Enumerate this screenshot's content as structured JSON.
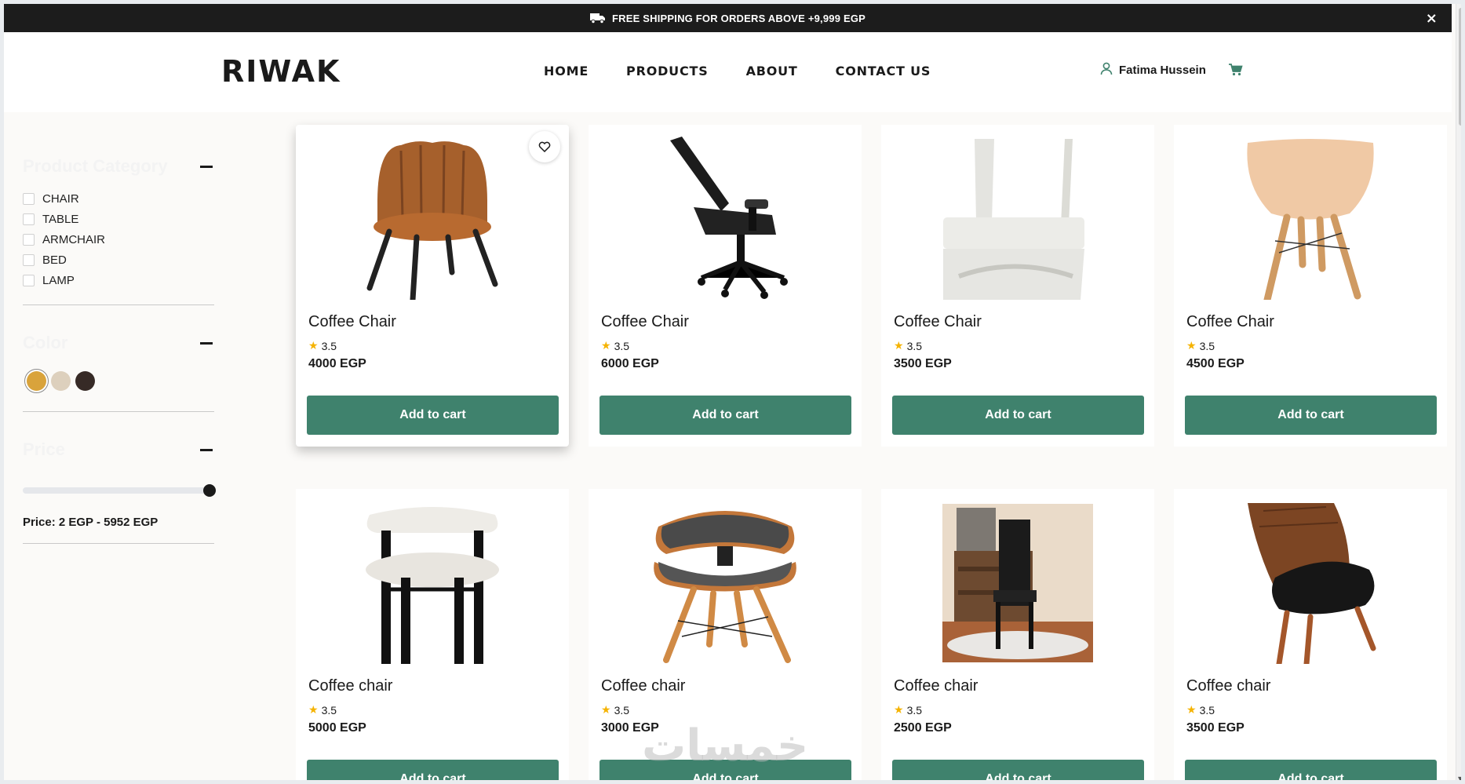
{
  "announcement": {
    "text": "FREE SHIPPING FOR ORDERS ABOVE +9,999 EGP",
    "icon": "truck-icon",
    "close_label": "×"
  },
  "header": {
    "logo": "RIWAK",
    "nav": [
      "HOME",
      "PRODUCTS",
      "ABOUT",
      "CONTACT US"
    ],
    "user_name": "Fatima Hussein",
    "accent": "#3f826d"
  },
  "filters": {
    "category_title": "Product Category",
    "categories": [
      "CHAIR",
      "TABLE",
      "ARMCHAIR",
      "BED",
      "LAMP"
    ],
    "color_title": "Color",
    "colors": [
      "#d9a33b",
      "#ddd0bd",
      "#362a26"
    ],
    "price_title": "Price",
    "price_range": "Price: 2 EGP - 5952 EGP"
  },
  "products": [
    {
      "name": "Coffee Chair",
      "rating": "3.5",
      "price": "4000 EGP",
      "button": "Add to cart"
    },
    {
      "name": "Coffee Chair",
      "rating": "3.5",
      "price": "6000 EGP",
      "button": "Add to cart"
    },
    {
      "name": "Coffee Chair",
      "rating": "3.5",
      "price": "3500 EGP",
      "button": "Add to cart"
    },
    {
      "name": "Coffee Chair",
      "rating": "3.5",
      "price": "4500 EGP",
      "button": "Add to cart"
    },
    {
      "name": "Coffee chair",
      "rating": "3.5",
      "price": "5000 EGP",
      "button": "Add to cart"
    },
    {
      "name": "Coffee chair",
      "rating": "3.5",
      "price": "3000 EGP",
      "button": "Add to cart"
    },
    {
      "name": "Coffee chair",
      "rating": "3.5",
      "price": "2500 EGP",
      "button": "Add to cart"
    },
    {
      "name": "Coffee chair",
      "rating": "3.5",
      "price": "3500 EGP",
      "button": "Add to cart"
    }
  ],
  "watermark": "خمسات",
  "colors": {
    "button": "#3f826d",
    "star": "#f5b301",
    "announce_bg": "#1c1c1c"
  }
}
